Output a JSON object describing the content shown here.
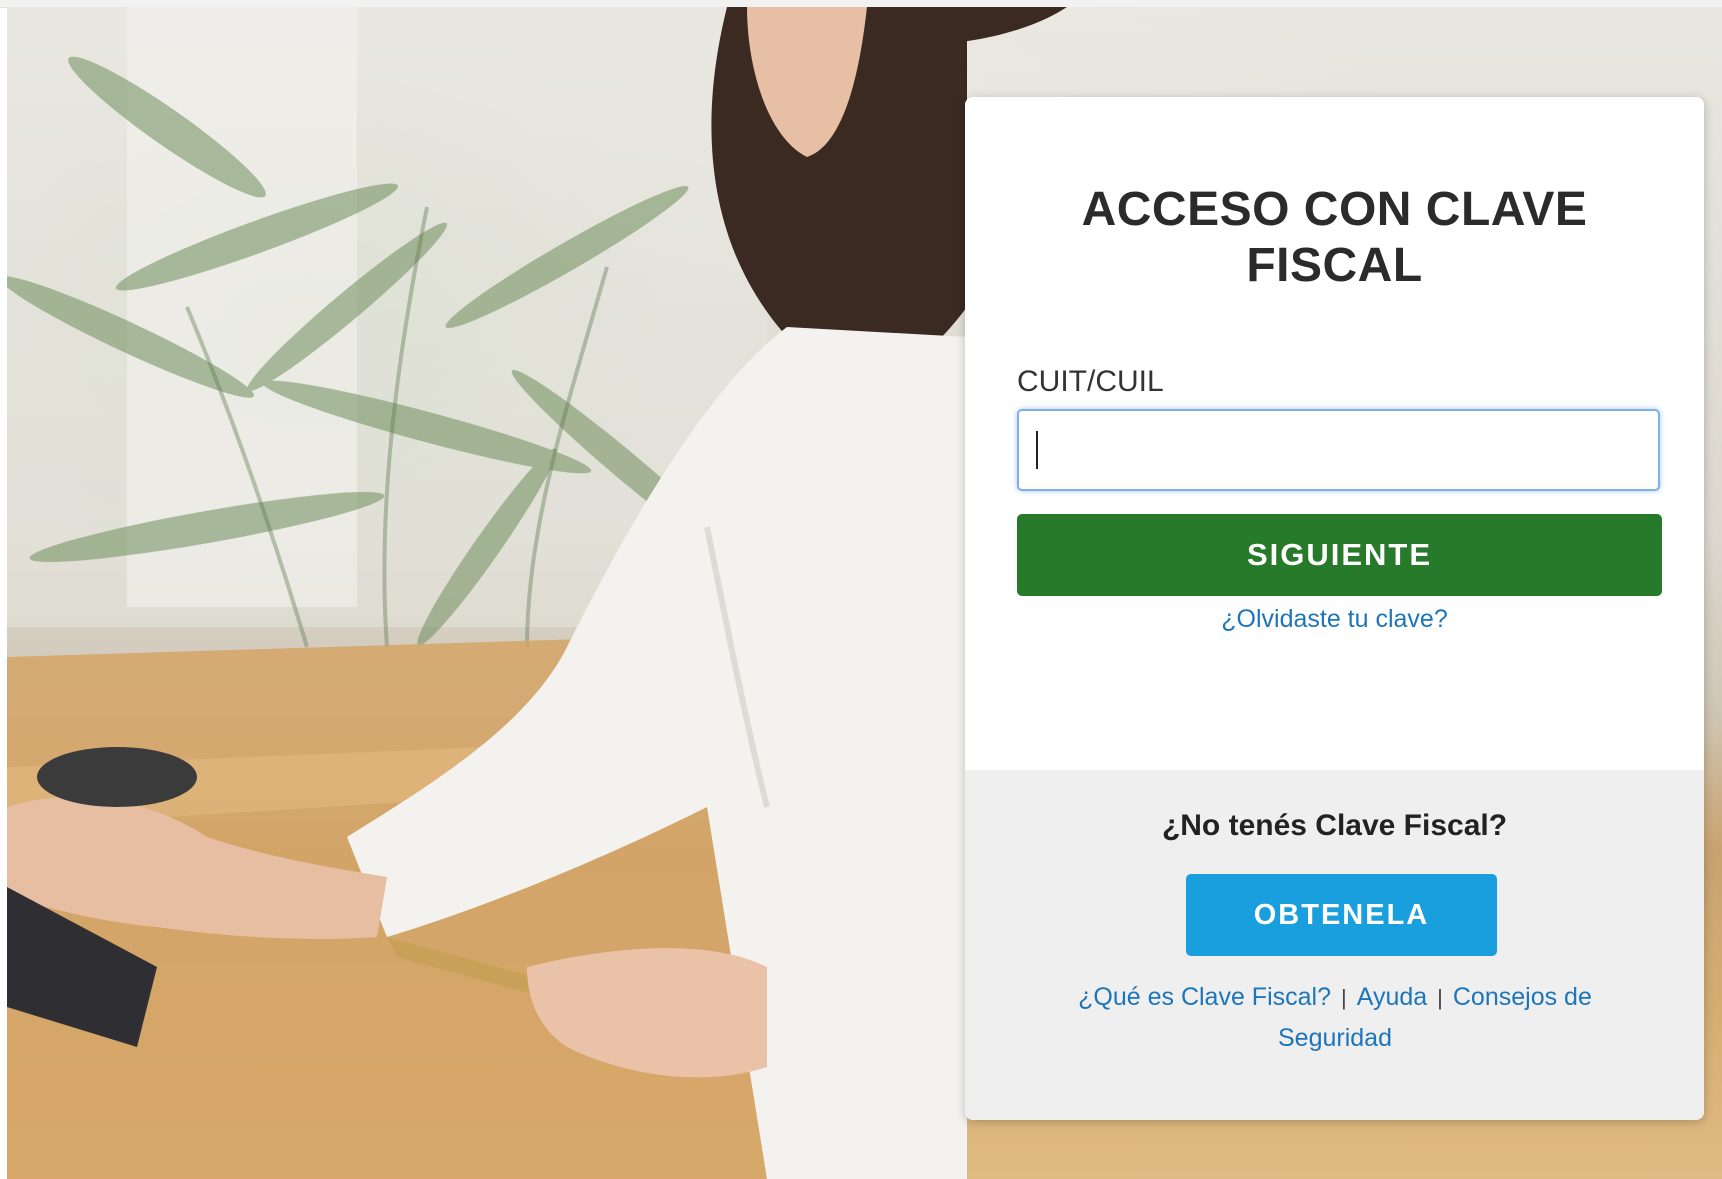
{
  "login": {
    "title": "ACCESO CON CLAVE FISCAL",
    "field_label": "CUIT/CUIL",
    "field_value": "",
    "next_button": "SIGUIENTE",
    "forgot_link": "¿Olvidaste tu clave?"
  },
  "signup": {
    "question": "¿No tenés Clave Fiscal?",
    "get_button": "OBTENELA",
    "links": {
      "what_is": "¿Qué es Clave Fiscal?",
      "separator": "|",
      "help": "Ayuda",
      "security": "Consejos de Seguridad"
    }
  },
  "colors": {
    "primary_button": "#267a2a",
    "secondary_button": "#1a9fde",
    "link": "#1d75bb"
  }
}
